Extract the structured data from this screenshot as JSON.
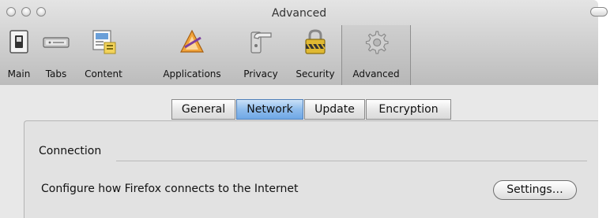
{
  "window": {
    "title": "Advanced"
  },
  "toolbar": {
    "items": [
      {
        "label": "Main",
        "icon": "switch-icon",
        "selected": false
      },
      {
        "label": "Tabs",
        "icon": "tabs-icon",
        "selected": false
      },
      {
        "label": "Content",
        "icon": "content-icon",
        "selected": false
      },
      {
        "label": "Applications",
        "icon": "applications-icon",
        "selected": false
      },
      {
        "label": "Privacy",
        "icon": "privacy-icon",
        "selected": false
      },
      {
        "label": "Security",
        "icon": "padlock-icon",
        "selected": false
      },
      {
        "label": "Advanced",
        "icon": "gear-icon",
        "selected": true
      }
    ]
  },
  "tabs": [
    {
      "label": "General",
      "active": false
    },
    {
      "label": "Network",
      "active": true
    },
    {
      "label": "Update",
      "active": false
    },
    {
      "label": "Encryption",
      "active": false
    }
  ],
  "connection": {
    "heading": "Connection",
    "description": "Configure how Firefox connects to the Internet",
    "button_label": "Settings…"
  },
  "colors": {
    "selected_tab": "#8fbcec",
    "toolbar_bg": "#c8c8c8",
    "content_bg": "#e8e8e8"
  }
}
